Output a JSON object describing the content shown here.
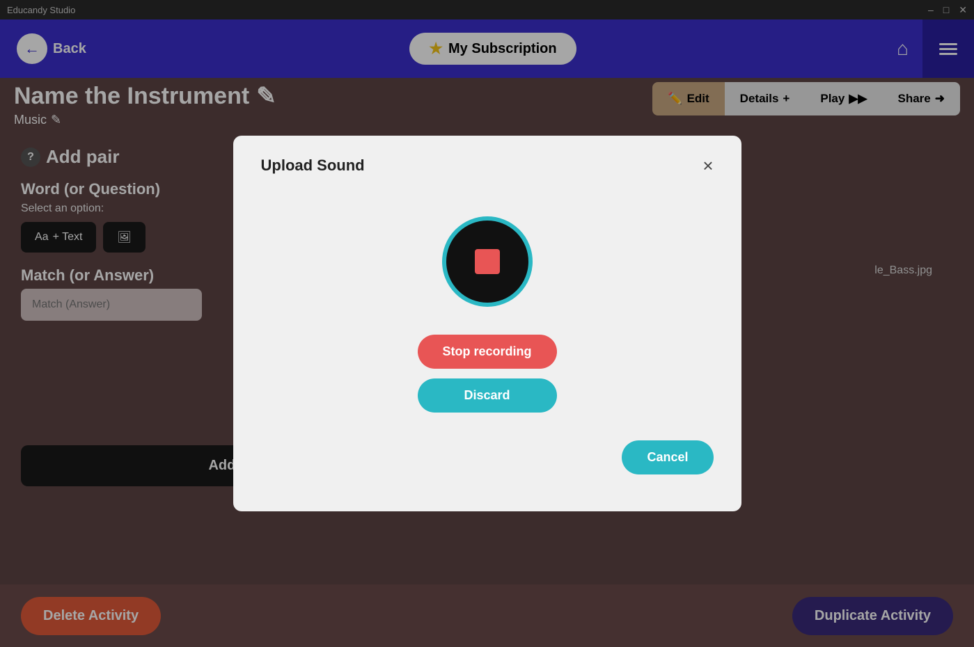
{
  "titleBar": {
    "appName": "Educandy Studio",
    "controls": [
      "minimize",
      "maximize",
      "close"
    ]
  },
  "topNav": {
    "backLabel": "Back",
    "subscriptionLabel": "My Subscription",
    "homeIcon": "home",
    "menuIcon": "menu"
  },
  "pageHeader": {
    "title": "Name the Instrument",
    "editIcon": "pencil",
    "subtitle": "Music",
    "subtitleEditIcon": "pencil"
  },
  "tabs": [
    {
      "id": "edit",
      "label": "Edit",
      "icon": "✏️",
      "active": true
    },
    {
      "id": "details",
      "label": "Details",
      "icon": "+"
    },
    {
      "id": "play",
      "label": "Play",
      "icon": "▶▶"
    },
    {
      "id": "share",
      "label": "Share",
      "icon": "share"
    }
  ],
  "addPair": {
    "icon": "?",
    "title": "Add pair",
    "wordLabel": "Word (or Question)",
    "selectOptionLabel": "Select an option:",
    "optionText": "+ Text",
    "matchLabel": "Match (or Answer)",
    "matchPlaceholder": "Match (Answer)",
    "addPairButtonLabel": "Add pair"
  },
  "rightContent": {
    "filename": "le_Bass.jpg"
  },
  "bottomBar": {
    "deleteLabel": "Delete Activity",
    "duplicateLabel": "Duplicate Activity"
  },
  "modal": {
    "title": "Upload Sound",
    "closeIcon": "×",
    "recordIcon": "stop-square",
    "stopRecordingLabel": "Stop recording",
    "discardLabel": "Discard",
    "cancelLabel": "Cancel"
  }
}
